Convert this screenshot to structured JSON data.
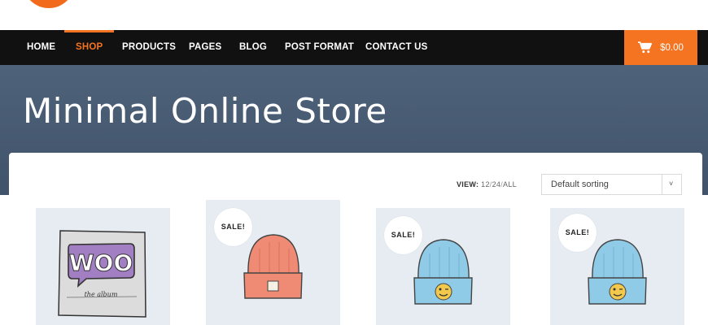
{
  "nav": {
    "items": [
      "HOME",
      "SHOP",
      "PRODUCTS",
      "PAGES",
      "BLOG",
      "POST FORMAT",
      "CONTACT US"
    ],
    "active": "SHOP"
  },
  "cart": {
    "total": "$0.00",
    "icon": "cart-icon"
  },
  "hero": {
    "title": "Minimal Online Store"
  },
  "toolbar": {
    "view_label": "VIEW:",
    "view_12": "12",
    "view_24": "24",
    "view_all": "ALL",
    "sep": "/",
    "sort_selected": "Default sorting"
  },
  "products": [
    {
      "sale": "",
      "art": "woo-album"
    },
    {
      "sale": "SALE!",
      "art": "beanie-orange"
    },
    {
      "sale": "SALE!",
      "art": "beanie-blue"
    },
    {
      "sale": "SALE!",
      "art": "beanie-blue"
    }
  ],
  "artwork": {
    "woo_text": "WOO",
    "album_text": "the album"
  },
  "colors": {
    "accent": "#f47421",
    "nav_bg": "#111111",
    "hero_bg": "#46596f",
    "product_bg": "#e6ecf1"
  }
}
